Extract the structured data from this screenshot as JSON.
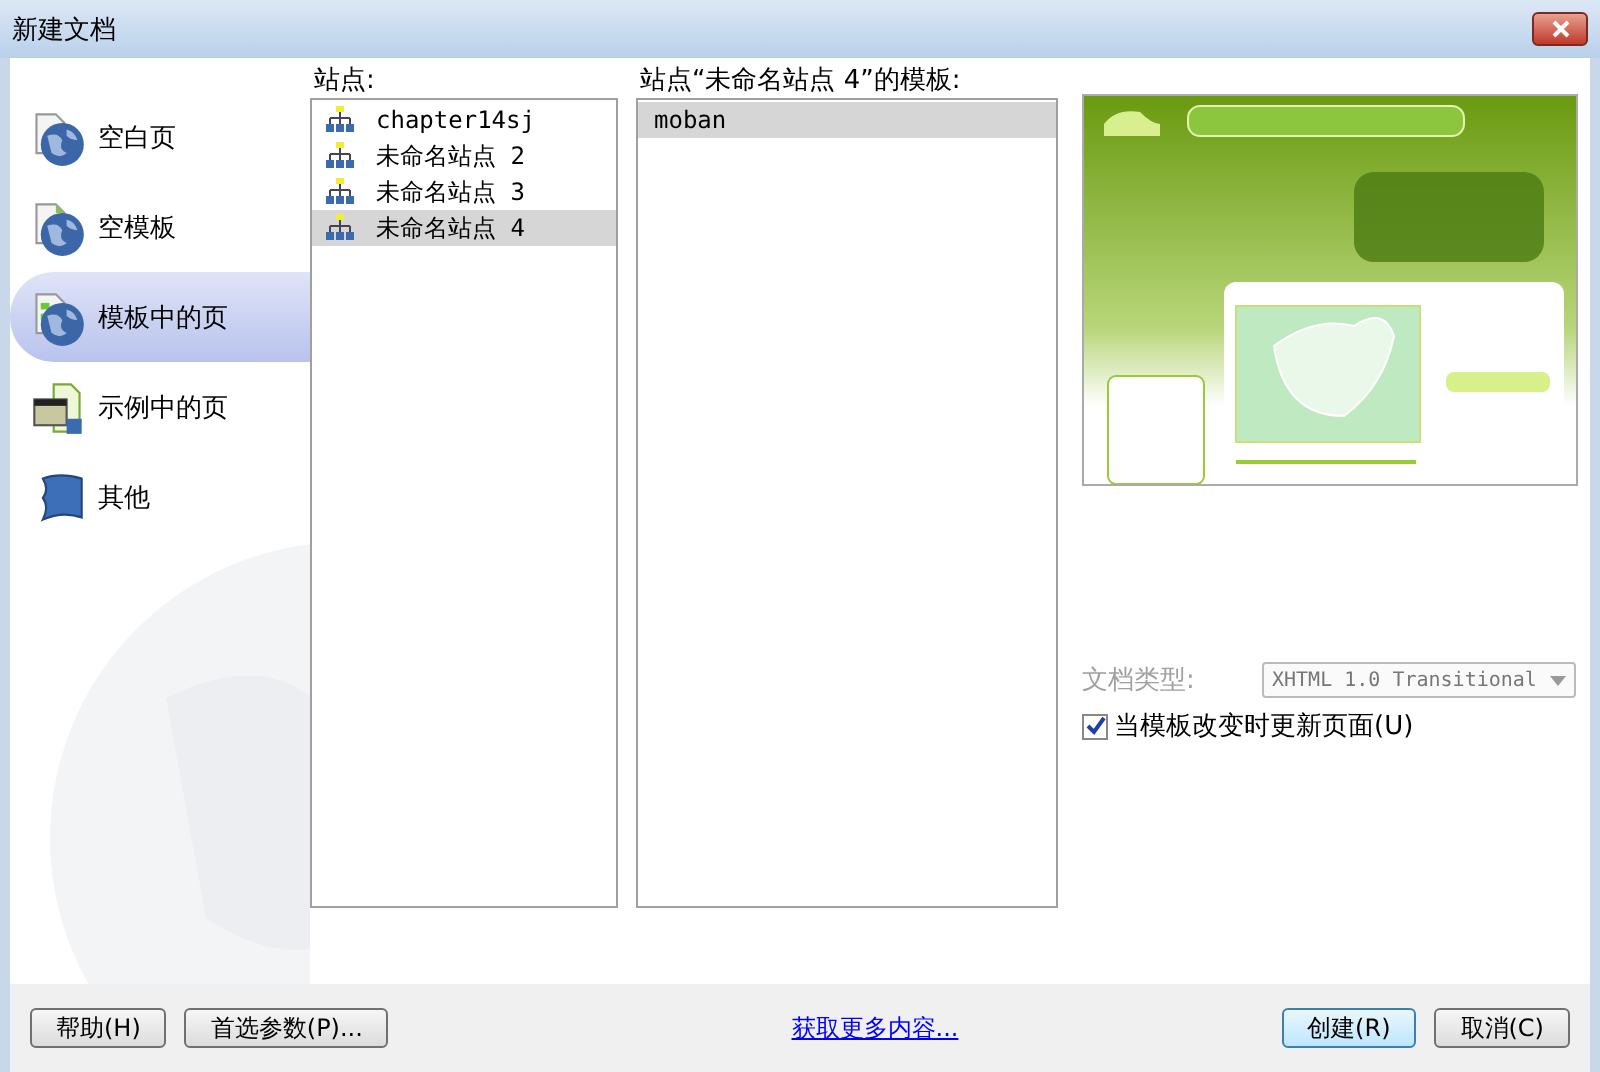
{
  "window": {
    "title": "新建文档"
  },
  "categories": [
    {
      "label": "空白页",
      "kind": "blank",
      "selected": false
    },
    {
      "label": "空模板",
      "kind": "template",
      "selected": false
    },
    {
      "label": "模板中的页",
      "kind": "site-template",
      "selected": true
    },
    {
      "label": "示例中的页",
      "kind": "sample",
      "selected": false
    },
    {
      "label": "其他",
      "kind": "other",
      "selected": false
    }
  ],
  "sites": {
    "label": "站点:",
    "items": [
      {
        "label": "chapter14sj",
        "selected": false
      },
      {
        "label": "未命名站点 2",
        "selected": false
      },
      {
        "label": "未命名站点 3",
        "selected": false
      },
      {
        "label": "未命名站点 4",
        "selected": true
      }
    ]
  },
  "templates": {
    "label": "站点“未命名站点 4”的模板:",
    "items": [
      {
        "label": "moban",
        "selected": true
      }
    ]
  },
  "doc_type": {
    "label": "文档类型:",
    "value": "XHTML 1.0 Transitional",
    "disabled": true
  },
  "update_checkbox": {
    "label": "当模板改变时更新页面(U)",
    "checked": true
  },
  "footer": {
    "buttons": [
      {
        "label": "帮助(H)",
        "kind": "left",
        "default": false
      },
      {
        "label": "首选参数(P)...",
        "kind": "left",
        "default": false
      },
      {
        "label": "创建(R)",
        "kind": "right",
        "default": true
      },
      {
        "label": "取消(C)",
        "kind": "right",
        "default": false
      }
    ],
    "link": "获取更多内容..."
  }
}
